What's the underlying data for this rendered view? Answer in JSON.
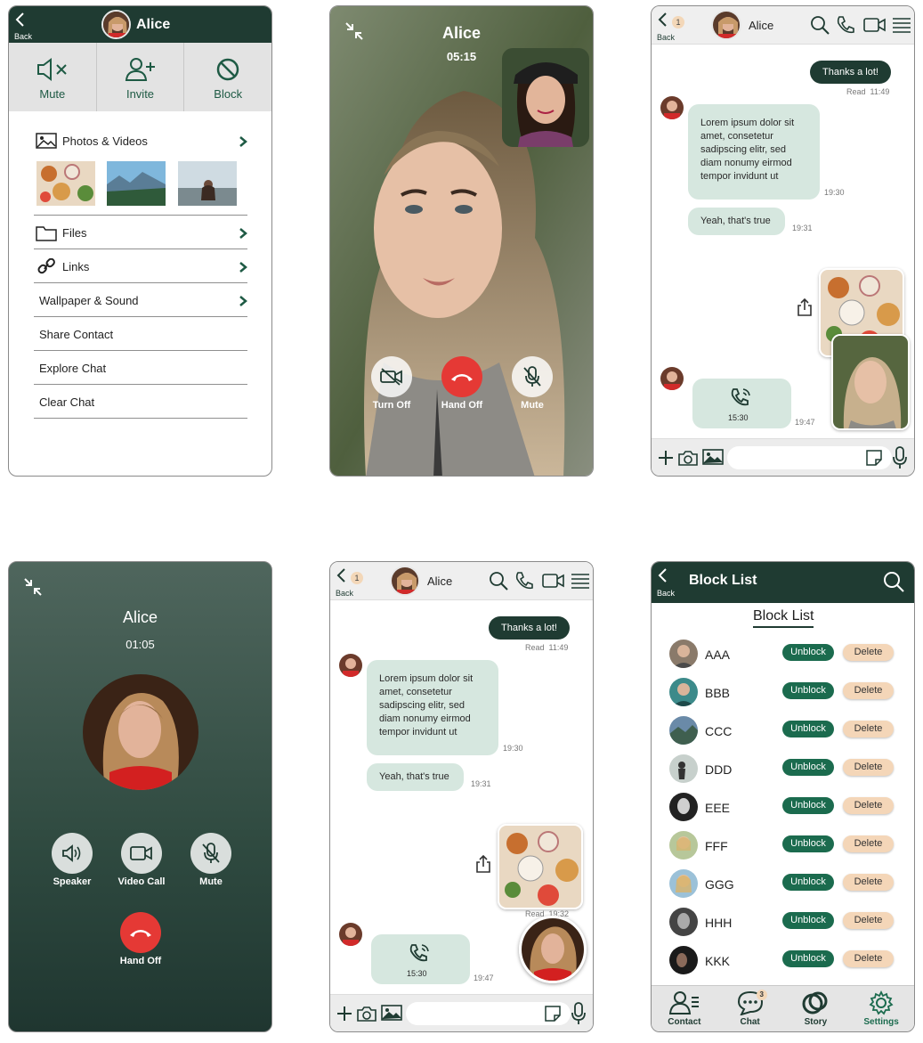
{
  "contact_info": {
    "back_label": "Back",
    "name": "Alice",
    "actions": [
      {
        "label": "Mute",
        "icon": "mute-icon"
      },
      {
        "label": "Invite",
        "icon": "add-user-icon"
      },
      {
        "label": "Block",
        "icon": "block-icon"
      }
    ],
    "menu": {
      "photos_videos": "Photos & Videos",
      "files": "Files",
      "links": "Links",
      "wallpaper_sound": "Wallpaper & Sound",
      "share_contact": "Share Contact",
      "explore_chat": "Explore Chat",
      "clear_chat": "Clear Chat"
    }
  },
  "video_call": {
    "name": "Alice",
    "timer": "05:15",
    "controls": {
      "turn_off": "Turn Off",
      "hand_off": "Hand Off",
      "mute": "Mute"
    }
  },
  "chat": {
    "back_label": "Back",
    "badge": "1",
    "name": "Alice",
    "messages": {
      "out_text": "Thanks a lot!",
      "out_status": "Read",
      "out_time": "11:49",
      "in_lorem": "Lorem ipsum dolor sit amet, consetetur sadipscing elitr, sed diam nonumy eirmod tempor invidunt ut",
      "in_lorem_time": "19:30",
      "in_yeah": "Yeah, that's true",
      "in_yeah_time": "19:31",
      "call_time": "15:30",
      "call_msg_time": "19:47",
      "image_status": "Read",
      "image_time": "19:32"
    }
  },
  "voice_call": {
    "name": "Alice",
    "timer": "01:05",
    "controls": {
      "speaker": "Speaker",
      "video_call": "Video Call",
      "mute": "Mute",
      "hand_off": "Hand Off"
    }
  },
  "block_list": {
    "back_label": "Back",
    "header_title": "Block List",
    "section_title": "Block List",
    "unblock_label": "Unblock",
    "delete_label": "Delete",
    "users": [
      {
        "name": "AAA"
      },
      {
        "name": "BBB"
      },
      {
        "name": "CCC"
      },
      {
        "name": "DDD"
      },
      {
        "name": "EEE"
      },
      {
        "name": "FFF"
      },
      {
        "name": "GGG"
      },
      {
        "name": "HHH"
      },
      {
        "name": "KKK"
      }
    ],
    "tabs": [
      {
        "label": "Contact",
        "icon": "contact-icon"
      },
      {
        "label": "Chat",
        "icon": "chat-icon",
        "badge": "3"
      },
      {
        "label": "Story",
        "icon": "story-icon"
      },
      {
        "label": "Settings",
        "icon": "settings-icon"
      }
    ]
  },
  "colors": {
    "primary": "#1f3b32",
    "accent": "#1b6b4e",
    "bubble": "#d6e7df",
    "delete": "#f4d6b8",
    "end_call": "#e53935"
  }
}
